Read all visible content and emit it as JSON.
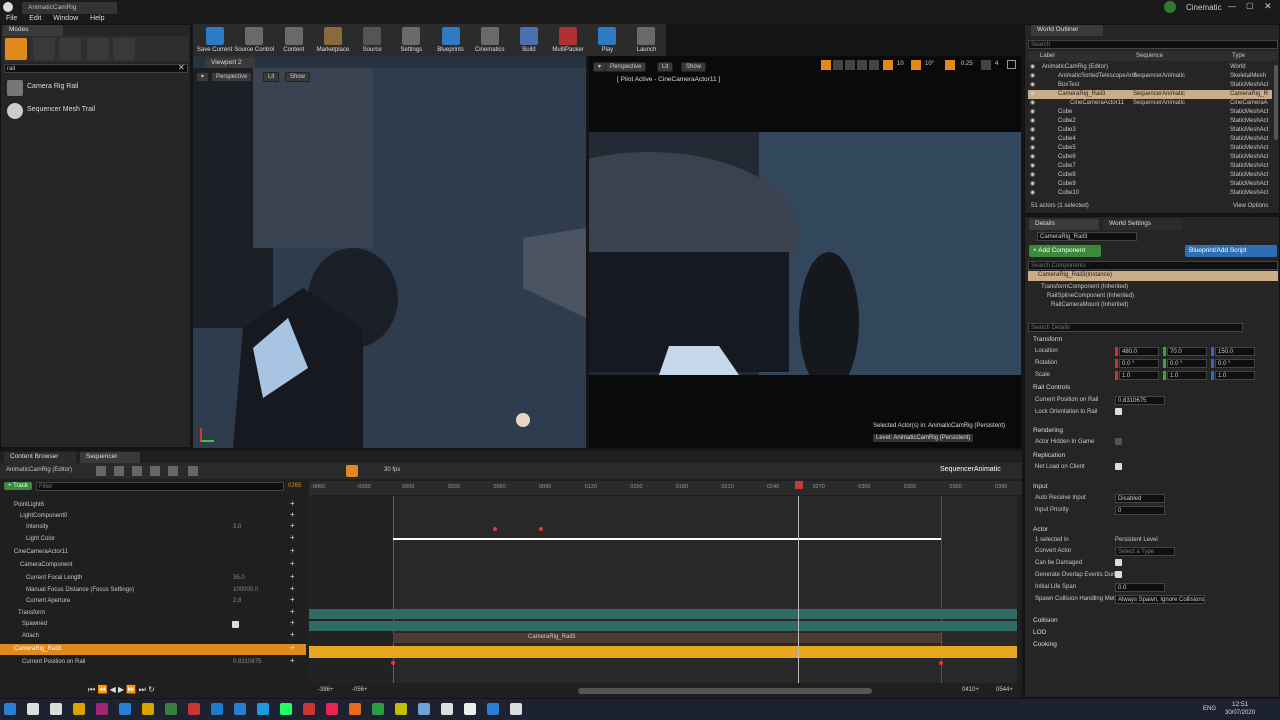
{
  "window": {
    "tab": "AnimaticCamRig",
    "brand": "Cinematic"
  },
  "menu": [
    "File",
    "Edit",
    "Window",
    "Help"
  ],
  "modes": {
    "tab": "Modes",
    "search": "rail",
    "results": [
      "Camera Rig Rail",
      "Sequencer Mesh Trail"
    ]
  },
  "toolbar": [
    "Save Current",
    "Source Control",
    "Content",
    "Marketplace",
    "Source",
    "Settings",
    "Blueprints",
    "Cinematics",
    "Build",
    "MultiPacker",
    "Play",
    "Launch"
  ],
  "viewport2": {
    "tab": "Viewport 2",
    "perspective": "Perspective",
    "lit": "Lit",
    "show": "Show"
  },
  "viewport1": {
    "perspective": "Perspective",
    "lit": "Lit",
    "show": "Show",
    "pilot": "[ Pilot Active - CineCameraActor11 ]",
    "selected": "Selected Actor(s) in:  AnimaticCamRig (Persistent)",
    "level": "Level:  AnimaticCamRig (Persistent)",
    "speed": "0.25",
    "cam": "4",
    "fov": "10",
    "angle": "10°"
  },
  "outliner": {
    "tab": "World Outliner",
    "search": "Search",
    "col_label": "Label",
    "col_seq": "Sequence",
    "col_type": "Type",
    "rows": [
      {
        "label": "AnimaticCamRig (Editor)",
        "seq": "",
        "type": "World"
      },
      {
        "label": "AnimaticSortedTelescopeArm",
        "seq": "SequencerAnimatic",
        "type": "SkeletalMesh"
      },
      {
        "label": "BoxTest",
        "seq": "",
        "type": "StaticMeshAct"
      },
      {
        "label": "CameraRig_Rail3",
        "seq": "SequencerAnimatic",
        "type": "CameraRig_R"
      },
      {
        "label": "CineCameraActor11",
        "seq": "SequencerAnimatic",
        "type": "CineCameraA"
      },
      {
        "label": "Cube",
        "seq": "",
        "type": "StaticMeshAct"
      },
      {
        "label": "Cube2",
        "seq": "",
        "type": "StaticMeshAct"
      },
      {
        "label": "Cube3",
        "seq": "",
        "type": "StaticMeshAct"
      },
      {
        "label": "Cube4",
        "seq": "",
        "type": "StaticMeshAct"
      },
      {
        "label": "Cube5",
        "seq": "",
        "type": "StaticMeshAct"
      },
      {
        "label": "Cube6",
        "seq": "",
        "type": "StaticMeshAct"
      },
      {
        "label": "Cube7",
        "seq": "",
        "type": "StaticMeshAct"
      },
      {
        "label": "Cube8",
        "seq": "",
        "type": "StaticMeshAct"
      },
      {
        "label": "Cube9",
        "seq": "",
        "type": "StaticMeshAct"
      },
      {
        "label": "Cube10",
        "seq": "",
        "type": "StaticMeshAct"
      }
    ],
    "footer": "51 actors (1 selected)",
    "view_options": "View Options"
  },
  "details": {
    "tab": "Details",
    "tab2": "World Settings",
    "name": "CameraRig_Rail3",
    "add_component": "+ Add Component",
    "blueprint": "Blueprint/Add Script",
    "search_components": "Search Components",
    "instance": "CameraRig_Rail3(Instance)",
    "components": [
      "TransformComponent (Inherited)",
      "RailSplineComponent (Inherited)",
      "RailCameraMount (Inherited)"
    ],
    "search_details": "Search Details",
    "transform": {
      "title": "Transform",
      "location": "Location",
      "rotation": "Rotation",
      "scale": "Scale",
      "loc": [
        "480.0",
        "70.0",
        "150.0"
      ],
      "rot": [
        "0.0 °",
        "0.0 °",
        "0.0 °"
      ],
      "scl": [
        "1.0",
        "1.0",
        "1.0"
      ]
    },
    "rail": {
      "title": "Rail Controls",
      "current": "Current Position on Rail",
      "current_val": "0.8310675",
      "lock": "Lock Orientation to Rail"
    },
    "rendering": {
      "title": "Rendering",
      "hidden": "Actor Hidden In Game"
    },
    "replication": {
      "title": "Replication",
      "net": "Net Load on Client"
    },
    "input": {
      "title": "Input",
      "auto": "Auto Receive Input",
      "auto_val": "Disabled",
      "priority": "Input Priority",
      "priority_val": "0"
    },
    "actor": {
      "title": "Actor",
      "selected": "1 selected in",
      "selected_val": "Persistent Level",
      "convert": "Convert Actor",
      "convert_val": "Select a Type",
      "damaged": "Can be Damaged",
      "overlap": "Generate Overlap Events During",
      "lifespan": "Initial Life Span",
      "lifespan_val": "0.0",
      "spawn": "Spawn Collision Handling Meth",
      "spawn_val": "Always Spawn, Ignore Collisions"
    },
    "collapsed": [
      "Collision",
      "LOD",
      "Cooking"
    ]
  },
  "sequencer": {
    "tab1": "Content Browser",
    "tab2": "Sequencer",
    "seq_name": "AnimaticCamRig (Editor)",
    "title": "SequencerAnimatic",
    "fps": "30 fps",
    "track": "+ Track",
    "filter": "Filter",
    "frame": "0265",
    "tracks": [
      {
        "label": "PointLight6",
        "val": ""
      },
      {
        "label": "LightComponent0",
        "val": ""
      },
      {
        "label": "Intensity",
        "val": "3.0"
      },
      {
        "label": "Light Color",
        "val": ""
      },
      {
        "label": "CineCameraActor11",
        "val": ""
      },
      {
        "label": "CameraComponent",
        "val": ""
      },
      {
        "label": "Current Focal Length",
        "val": "35.0"
      },
      {
        "label": "Manual Focus Distance (Focus Settings)",
        "val": "100000.0"
      },
      {
        "label": "Current Aperture",
        "val": "2.8"
      },
      {
        "label": "Transform",
        "val": ""
      },
      {
        "label": "Spawned",
        "val": ""
      },
      {
        "label": "Attach",
        "val": ""
      },
      {
        "label": "CameraRig_Rail3",
        "val": ""
      },
      {
        "label": "Current Position on Rail",
        "val": "0.8310675"
      }
    ],
    "ruler": [
      "-0060",
      "-0030",
      "0000",
      "0030",
      "0060",
      "0090",
      "0120",
      "0150",
      "0180",
      "0210",
      "0240",
      "0270",
      "0300",
      "0330",
      "0360",
      "0390"
    ],
    "attach_section": "CameraRig_Rail3",
    "bottom": {
      "start": "-386+",
      "lo": "-056+",
      "hi": "0410+",
      "end": "0544+"
    }
  },
  "taskbar": {
    "time": "12:51",
    "date": "30/07/2020",
    "lang": "ENG"
  }
}
